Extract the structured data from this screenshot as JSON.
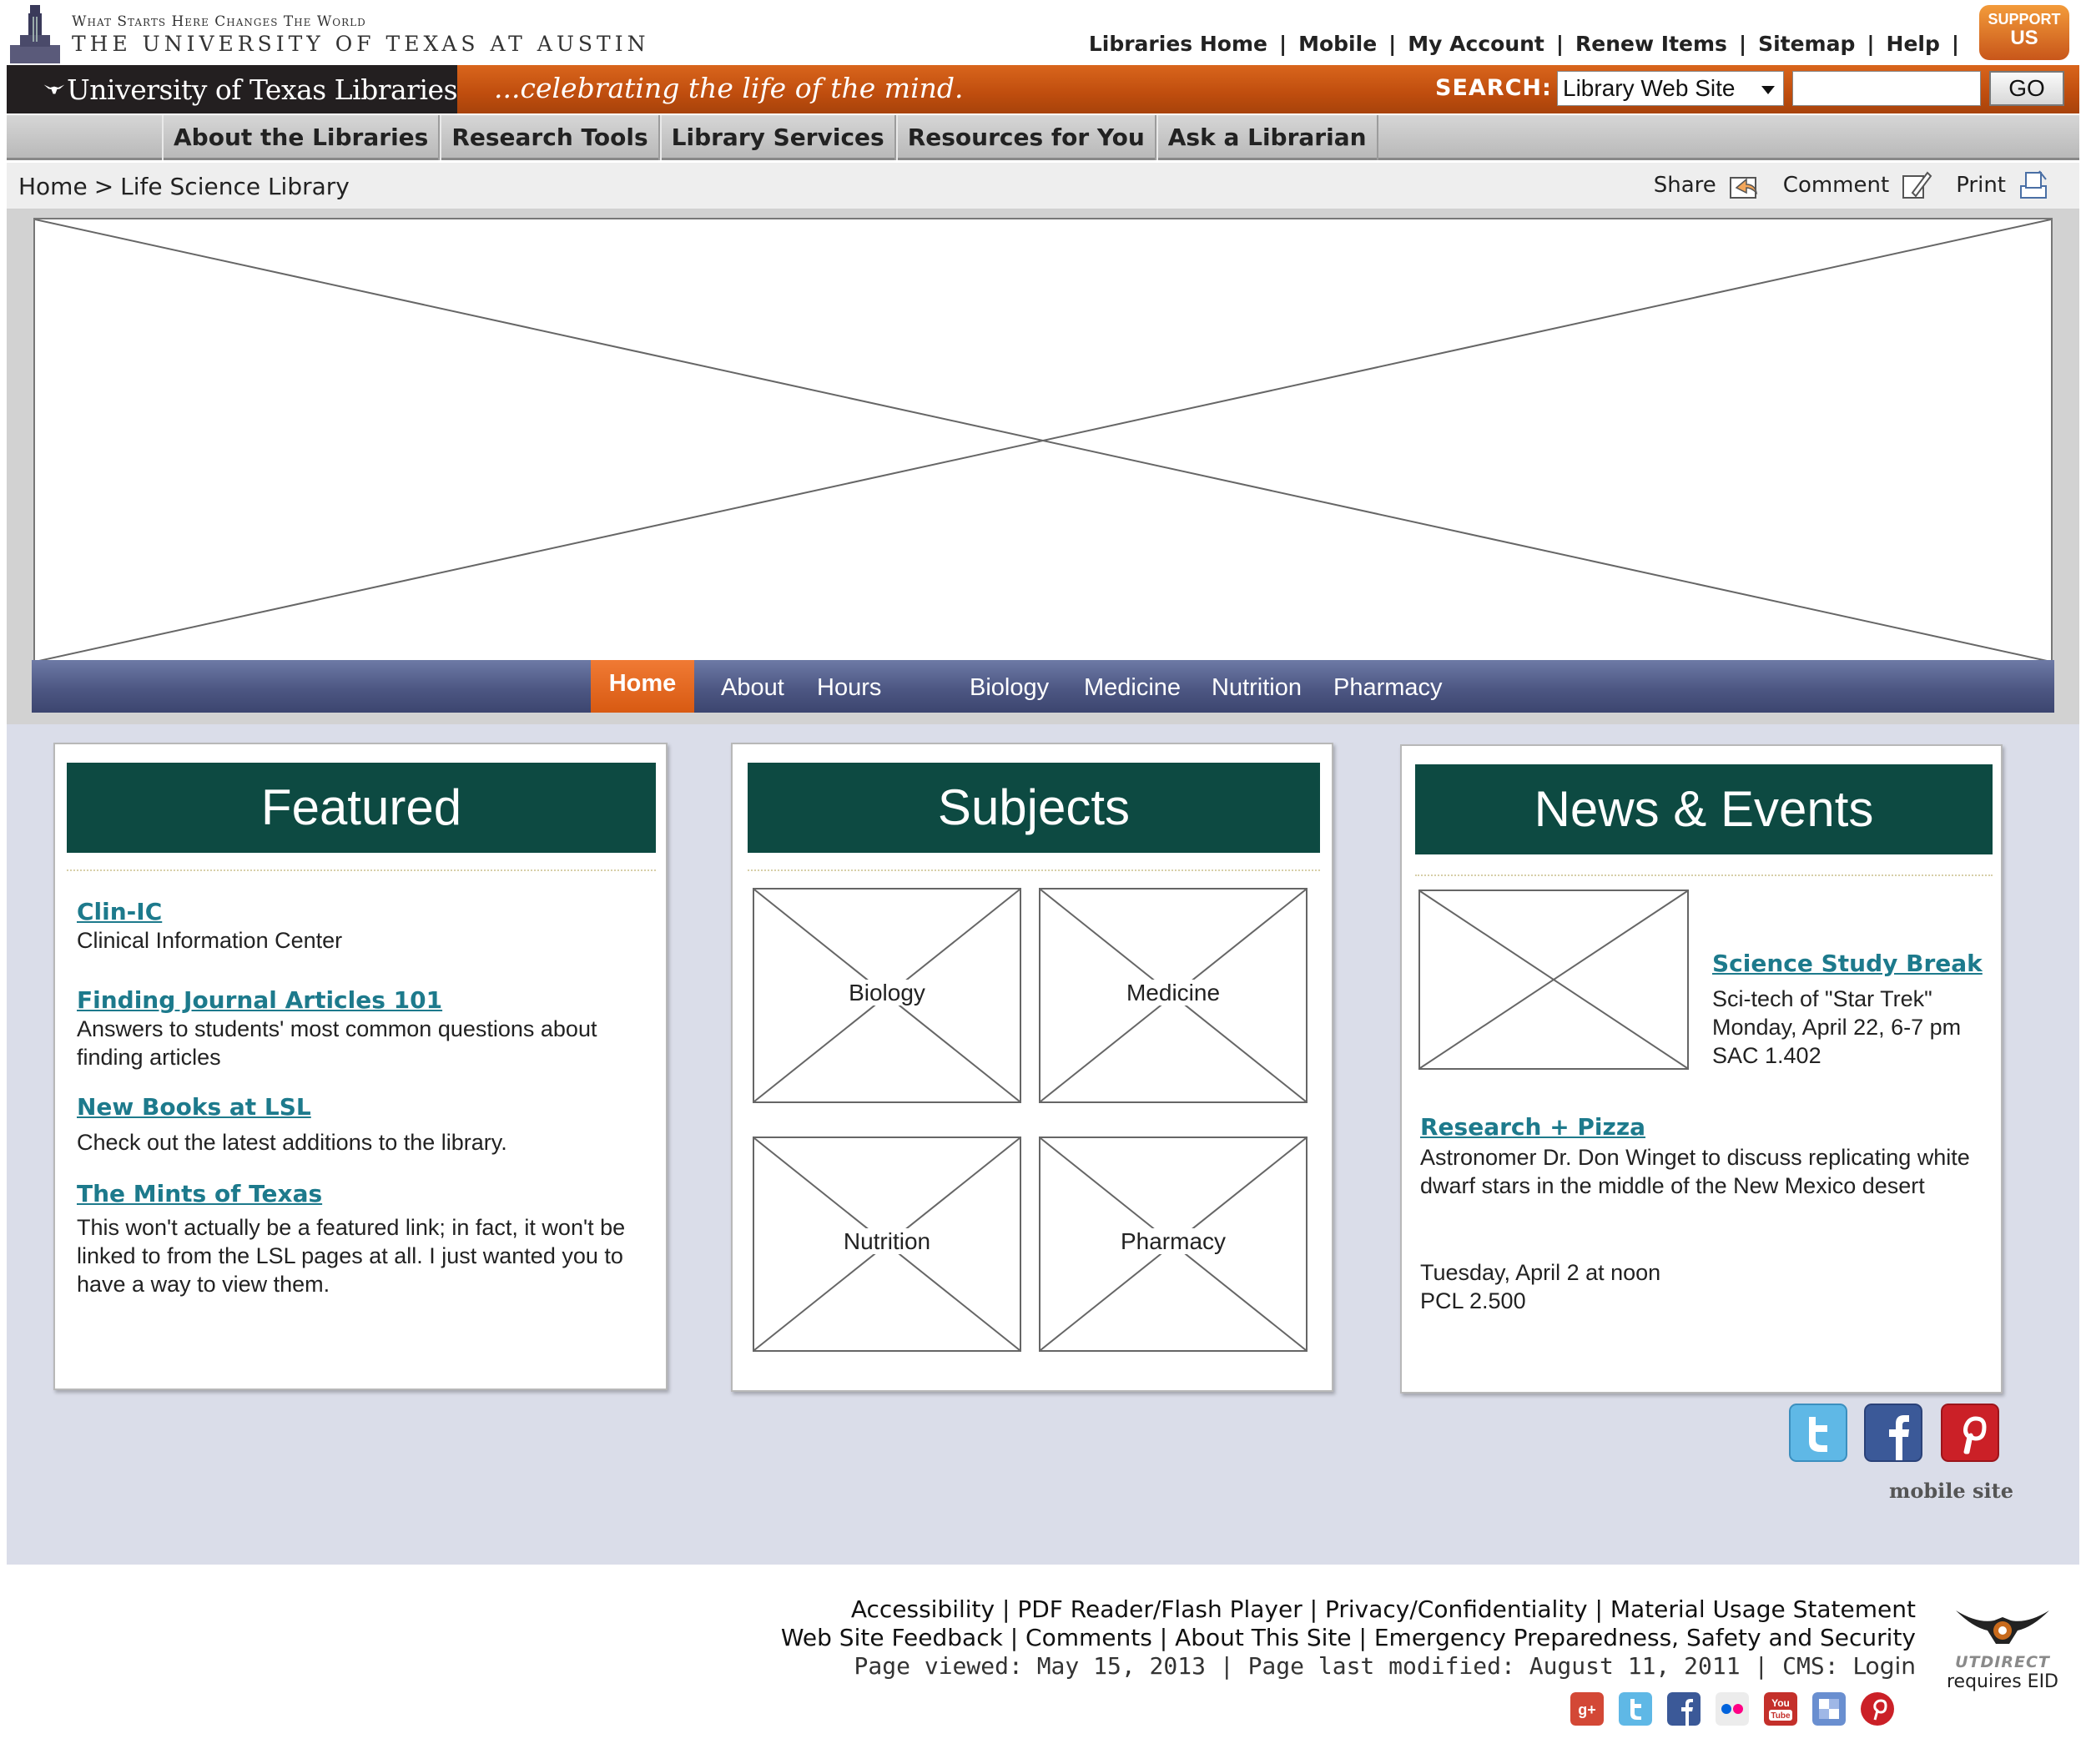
{
  "header": {
    "tagline": "What Starts Here Changes The World",
    "university": "THE UNIVERSITY OF TEXAS AT AUSTIN",
    "util_links": [
      "Libraries Home",
      "Mobile",
      "My Account",
      "Renew Items",
      "Sitemap",
      "Help"
    ],
    "support_line1": "SUPPORT",
    "support_line2": "US"
  },
  "banner": {
    "library_name": "University of Texas Libraries",
    "motto": "...celebrating the life of the mind.",
    "search_label": "SEARCH:",
    "search_scope": "Library Web Site",
    "search_value": "",
    "go_label": "GO"
  },
  "main_nav": [
    "About the Libraries",
    "Research Tools",
    "Library Services",
    "Resources for You",
    "Ask a Librarian"
  ],
  "breadcrumb": {
    "home": "Home",
    "separator": ">",
    "current": "Life Science Library"
  },
  "tools": {
    "share": "Share",
    "comment": "Comment",
    "print": "Print"
  },
  "lsl_nav": {
    "home": "Home",
    "items": [
      "About",
      "Hours",
      "Biology",
      "Medicine",
      "Nutrition",
      "Pharmacy"
    ]
  },
  "featured": {
    "title": "Featured",
    "items": [
      {
        "link": "Clin-IC",
        "desc": "Clinical Information Center"
      },
      {
        "link": "Finding Journal Articles 101",
        "desc": "Answers to students' most common questions about finding articles"
      },
      {
        "link": "New Books at LSL",
        "desc": "Check out the latest additions to the library."
      },
      {
        "link": "The Mints of Texas",
        "desc": "This won't actually be a featured link; in fact, it won't be linked to from the LSL pages at all.  I just wanted you to have a way to view them."
      }
    ]
  },
  "subjects": {
    "title": "Subjects",
    "items": [
      "Biology",
      "Medicine",
      "Nutrition",
      "Pharmacy"
    ]
  },
  "news": {
    "title": "News & Events",
    "items": [
      {
        "link": "Science Study Break",
        "lines": [
          "Sci-tech of \"Star Trek\"",
          "Monday, April 22, 6-7 pm",
          "SAC 1.402"
        ]
      },
      {
        "link": "Research + Pizza",
        "desc": "Astronomer Dr. Don Winget to discuss replicating white dwarf stars in the middle of the New Mexico desert",
        "lines": [
          "Tuesday, April 2 at noon",
          "PCL 2.500"
        ]
      }
    ]
  },
  "social_icons": [
    "twitter-icon",
    "facebook-icon",
    "pinterest-icon"
  ],
  "mobile_site": "mobile site",
  "footer": {
    "line1": [
      "Accessibility",
      "PDF Reader/Flash Player",
      "Privacy/Confidentiality",
      "Material Usage Statement"
    ],
    "line2": [
      "Web Site Feedback",
      "Comments",
      "About This Site",
      "Emergency Preparedness, Safety and Security"
    ],
    "page_viewed": "Page viewed: May 15, 2013",
    "last_modified": "Page last modified: August 11, 2011",
    "cms_label": "CMS:",
    "cms_login": "Login",
    "utdirect_label": "UTDIRECT",
    "utdirect_note": "requires EID",
    "icons": [
      "google-plus-icon",
      "twitter-icon",
      "facebook-icon",
      "flickr-icon",
      "youtube-icon",
      "delicious-icon",
      "pinterest-icon"
    ]
  },
  "colors": {
    "ut_orange": "#bf5700",
    "panel_header_green": "#0d4a42",
    "link_teal": "#1d7a8c",
    "lsl_nav_blue": "#4d5783"
  }
}
